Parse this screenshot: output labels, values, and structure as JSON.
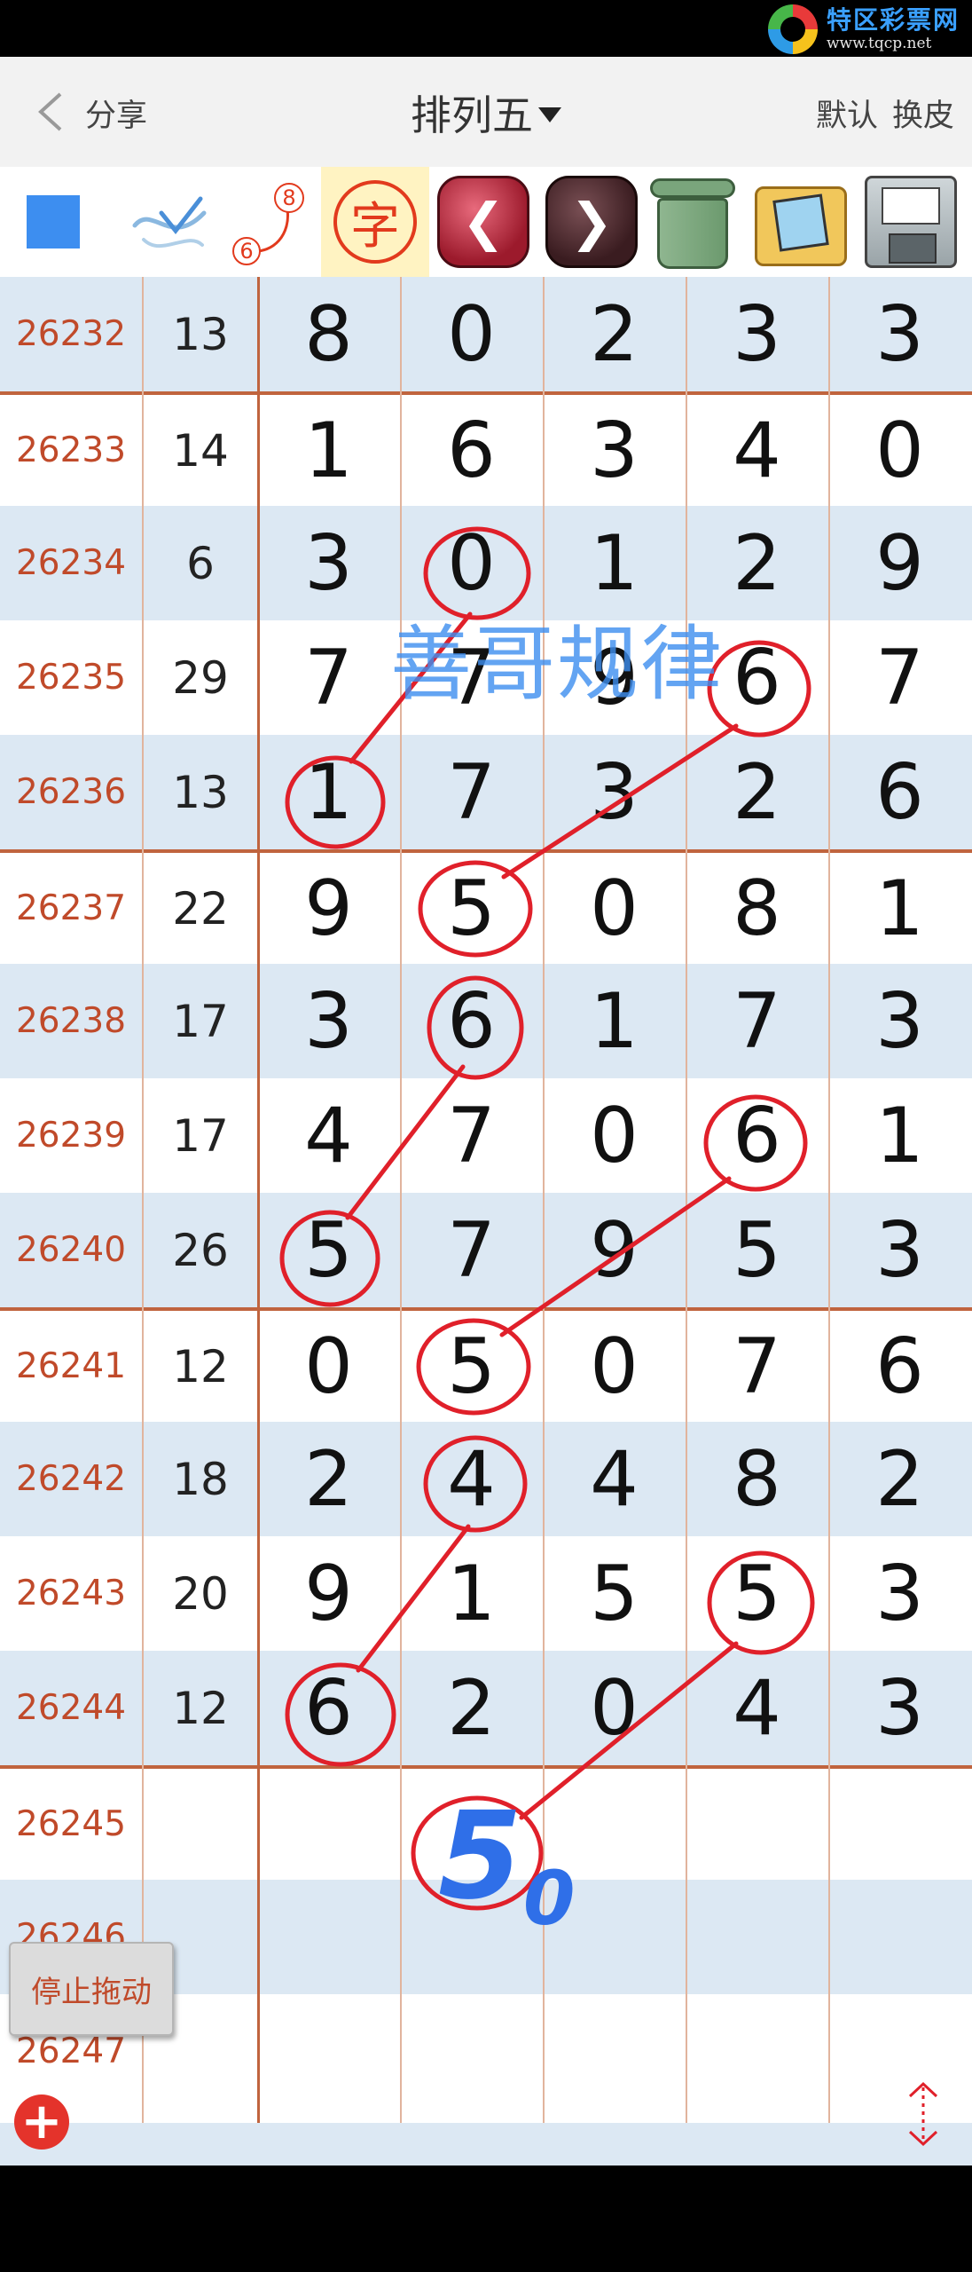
{
  "status_bar": {
    "brand_name": "特区彩票网",
    "brand_url": "www.tqcp.net"
  },
  "nav": {
    "share": "分享",
    "title": "排列五",
    "default": "默认",
    "skin": "换皮"
  },
  "toolbar": {
    "char_tool": "字",
    "curve_tool_top": "8",
    "curve_tool_bottom": "6"
  },
  "rows": [
    {
      "issue": "26232",
      "sum": "13",
      "d": [
        "8",
        "0",
        "2",
        "3",
        "3"
      ]
    },
    {
      "issue": "26233",
      "sum": "14",
      "d": [
        "1",
        "6",
        "3",
        "4",
        "0"
      ]
    },
    {
      "issue": "26234",
      "sum": "6",
      "d": [
        "3",
        "0",
        "1",
        "2",
        "9"
      ]
    },
    {
      "issue": "26235",
      "sum": "29",
      "d": [
        "7",
        "7",
        "9",
        "6",
        "7"
      ]
    },
    {
      "issue": "26236",
      "sum": "13",
      "d": [
        "1",
        "7",
        "3",
        "2",
        "6"
      ]
    },
    {
      "issue": "26237",
      "sum": "22",
      "d": [
        "9",
        "5",
        "0",
        "8",
        "1"
      ]
    },
    {
      "issue": "26238",
      "sum": "17",
      "d": [
        "3",
        "6",
        "1",
        "7",
        "3"
      ]
    },
    {
      "issue": "26239",
      "sum": "17",
      "d": [
        "4",
        "7",
        "0",
        "6",
        "1"
      ]
    },
    {
      "issue": "26240",
      "sum": "26",
      "d": [
        "5",
        "7",
        "9",
        "5",
        "3"
      ]
    },
    {
      "issue": "26241",
      "sum": "12",
      "d": [
        "0",
        "5",
        "0",
        "7",
        "6"
      ]
    },
    {
      "issue": "26242",
      "sum": "18",
      "d": [
        "2",
        "4",
        "4",
        "8",
        "2"
      ]
    },
    {
      "issue": "26243",
      "sum": "20",
      "d": [
        "9",
        "1",
        "5",
        "5",
        "3"
      ]
    },
    {
      "issue": "26244",
      "sum": "12",
      "d": [
        "6",
        "2",
        "0",
        "4",
        "3"
      ]
    },
    {
      "issue": "26245",
      "sum": "",
      "d": [
        "",
        "",
        "",
        "",
        ""
      ]
    },
    {
      "issue": "26246",
      "sum": "",
      "d": [
        "",
        "",
        "",
        "",
        ""
      ]
    },
    {
      "issue": "26247",
      "sum": "",
      "d": [
        "",
        "",
        "",
        "",
        ""
      ]
    }
  ],
  "annotation": {
    "watermark": "善哥规律",
    "prediction": "5",
    "prediction_sub": "0"
  },
  "controls": {
    "stop_drag": "停止拖动",
    "add": "+"
  },
  "colors": {
    "issue_text": "#c04a2a",
    "row_shade": "#dce8f3",
    "separator": "#c0643e",
    "annotation_red": "#e0202a",
    "annotation_blue": "#3d8ef0"
  }
}
